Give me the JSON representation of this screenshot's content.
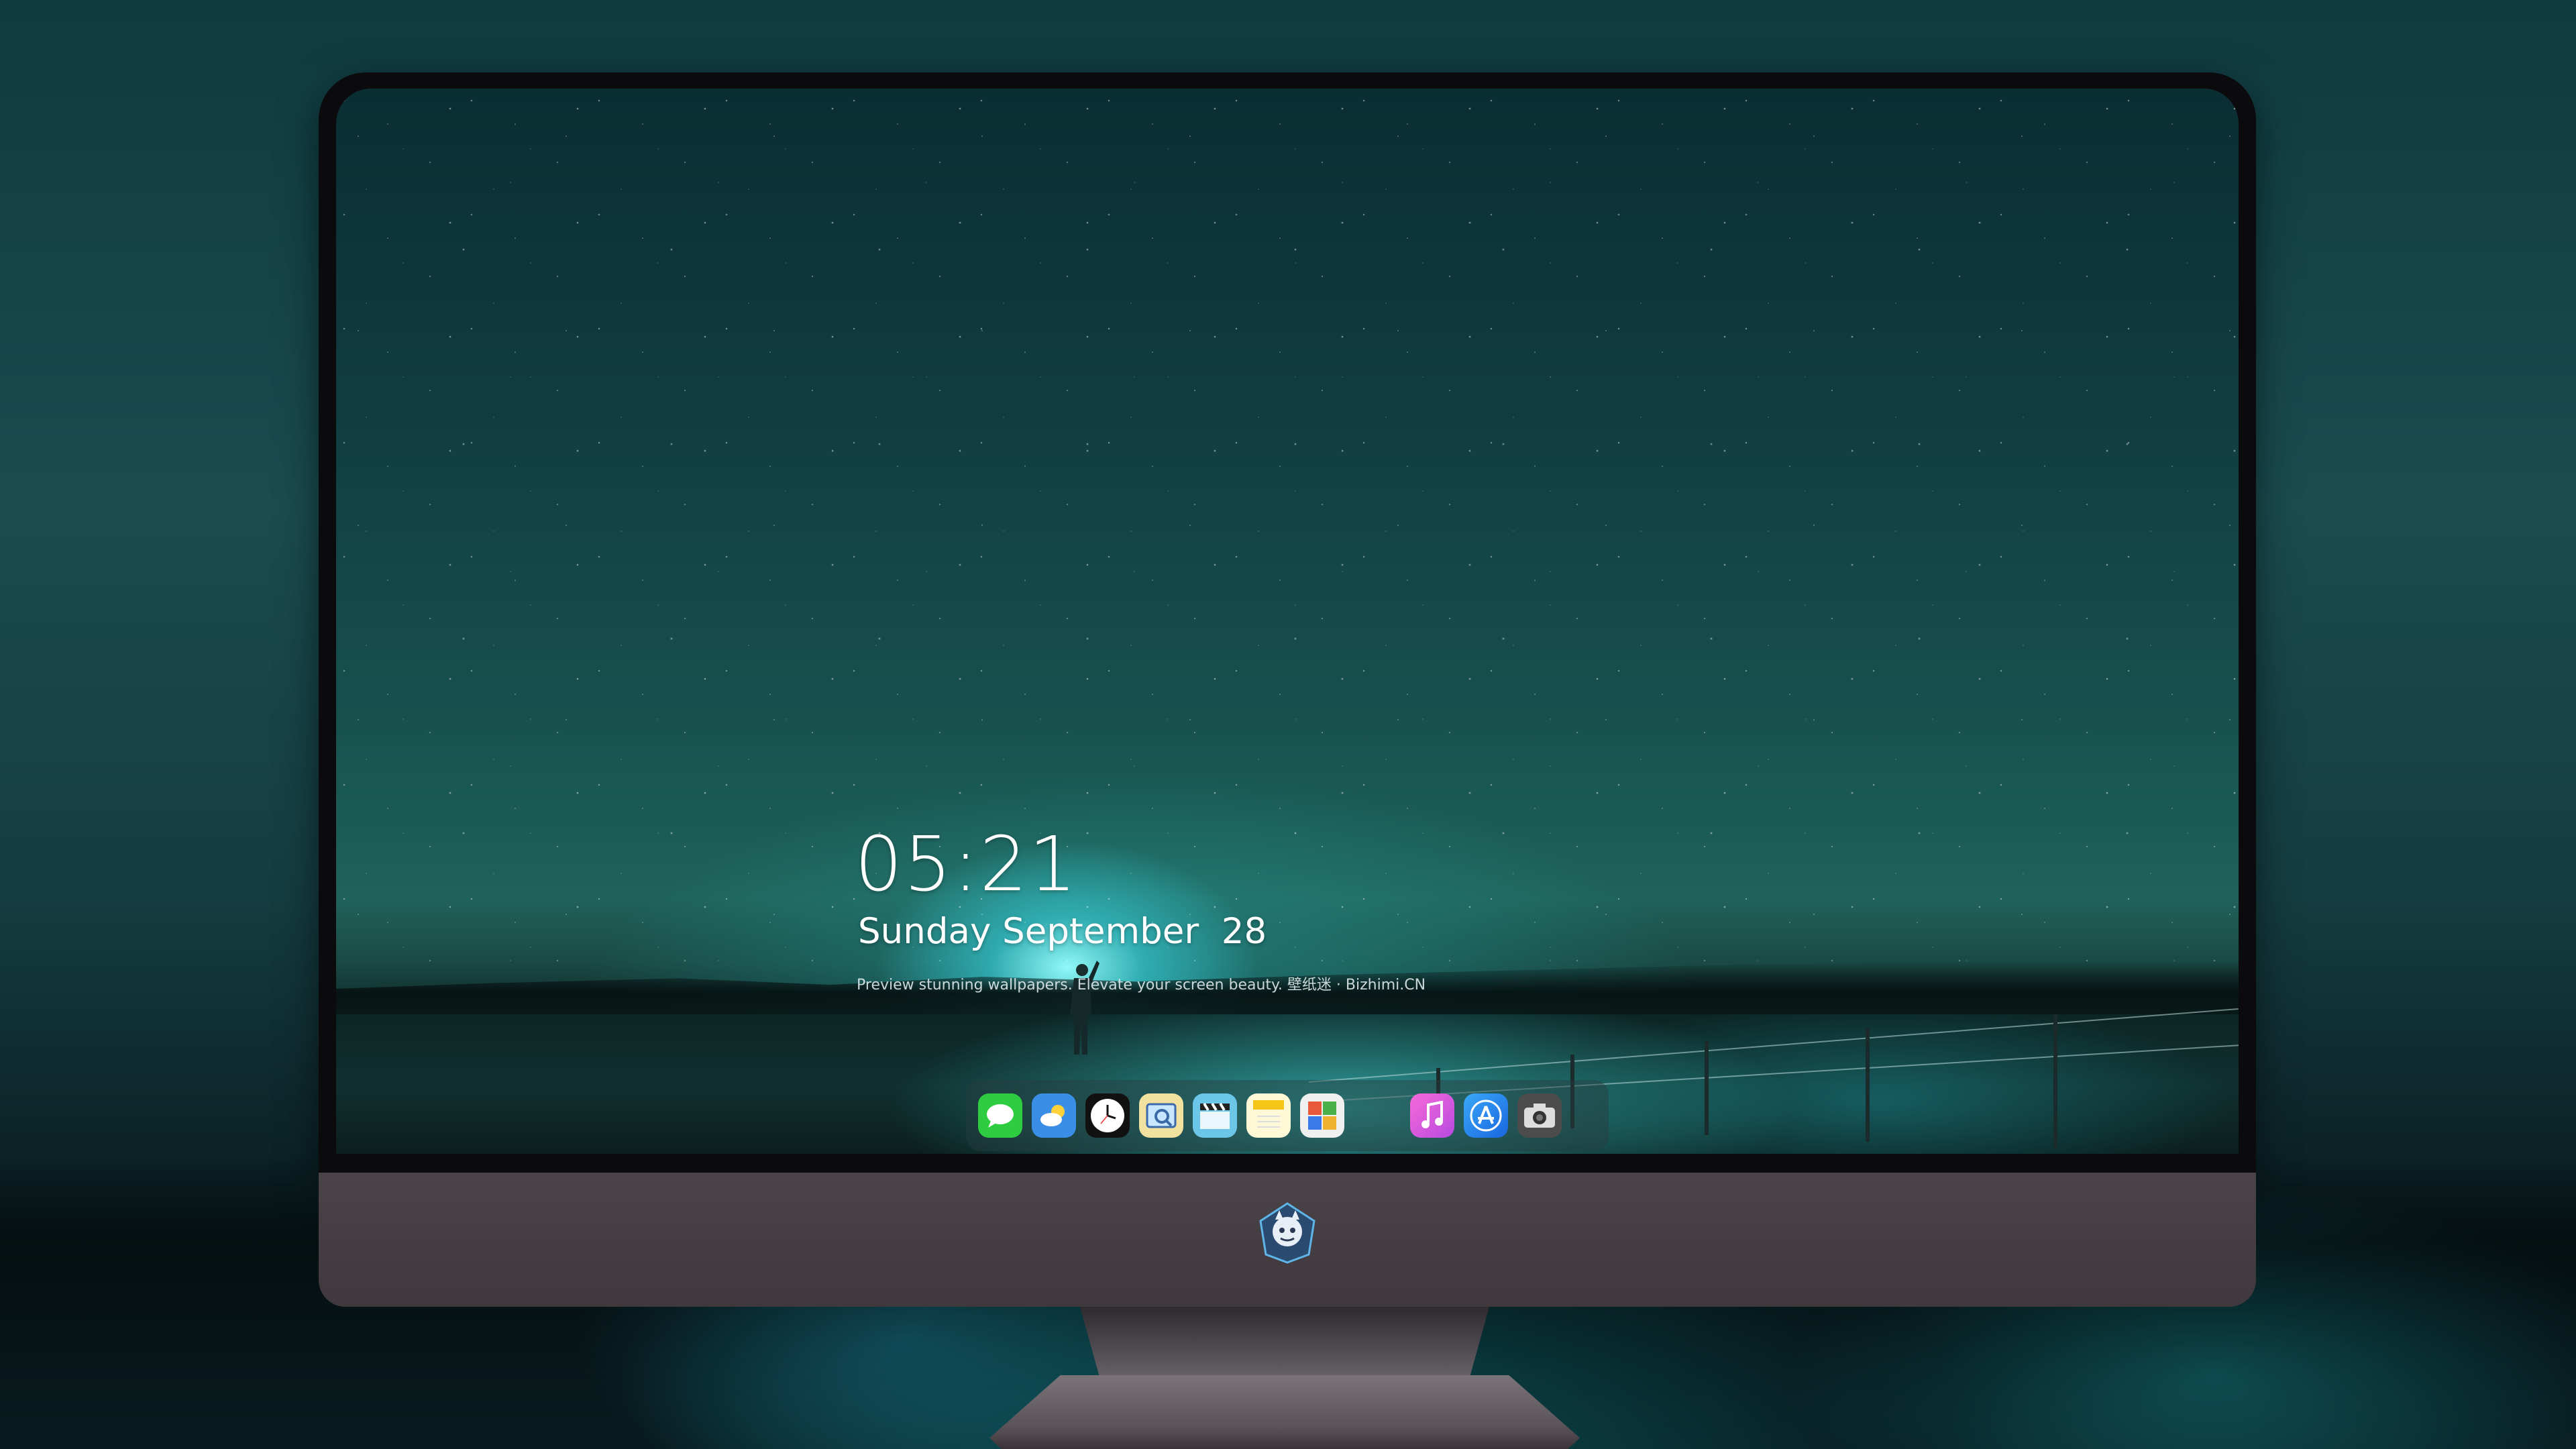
{
  "lockscreen": {
    "time": "05:21",
    "date": "Sunday September  28",
    "tagline": "Preview stunning wallpapers. Elevate your screen beauty. 壁纸迷 · Bizhimi.CN"
  },
  "dock": {
    "apps": [
      {
        "name": "messages-icon",
        "glyph": "💬",
        "bg": "#2ecc40"
      },
      {
        "name": "weather-icon",
        "glyph": "⛅",
        "bg": "#3a8ee6"
      },
      {
        "name": "clock-icon",
        "glyph": "🕒",
        "bg": "#1a1a1a"
      },
      {
        "name": "preview-icon",
        "glyph": "🔍",
        "bg": "#e8d070"
      },
      {
        "name": "clapper-icon",
        "glyph": "🎬",
        "bg": "#6cc6e8"
      },
      {
        "name": "notes-icon",
        "glyph": "📝",
        "bg": "#f5d44a"
      },
      {
        "name": "photo-booth-icon",
        "glyph": "🖼",
        "bg": "#e8e8e8"
      },
      {
        "name": "music-icon",
        "glyph": "♫",
        "bg": "#e05ad0"
      },
      {
        "name": "app-store-icon",
        "glyph": "A",
        "bg": "#2a86f0"
      },
      {
        "name": "camera-icon",
        "glyph": "📷",
        "bg": "#555555"
      }
    ]
  },
  "colors": {
    "accent_glow": "#9ff7ff",
    "chin": "#4a4449",
    "bezel": "#0b0b0d"
  }
}
